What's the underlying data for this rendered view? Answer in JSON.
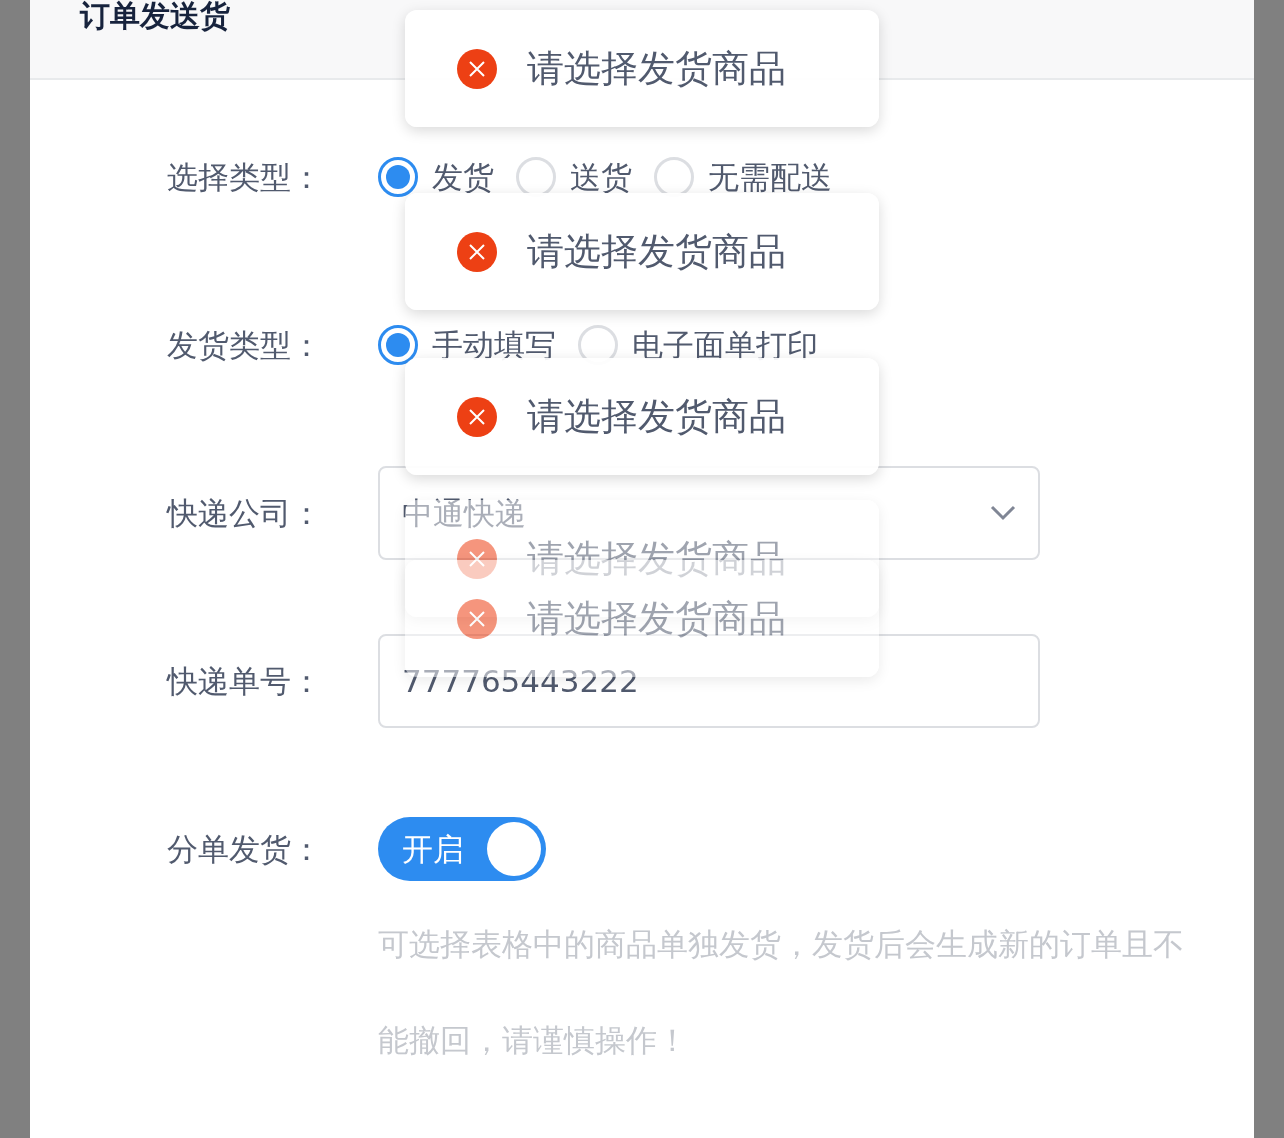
{
  "dialog": {
    "title": "订单发送货"
  },
  "form": [
    {
      "kind": "radio",
      "label": "选择类型：",
      "options": [
        {
          "label": "发货",
          "selected": true
        },
        {
          "label": "送货",
          "selected": false
        },
        {
          "label": "无需配送",
          "selected": false
        }
      ]
    },
    {
      "kind": "radio",
      "label": "发货类型：",
      "options": [
        {
          "label": "手动填写",
          "selected": true
        },
        {
          "label": "电子面单打印",
          "selected": false
        }
      ]
    },
    {
      "kind": "select",
      "label": "快递公司：",
      "value": "中通快递"
    },
    {
      "kind": "input",
      "label": "快递单号：",
      "value": "777765443222"
    },
    {
      "kind": "switch",
      "label": "分单发货：",
      "on": true,
      "state_text": "开启",
      "help": "可选择表格中的商品单独发货，发货后会生成新的订单且不能撤回，请谨慎操作！"
    }
  ],
  "toasts": [
    {
      "kind": "error",
      "message": "请选择发货商品",
      "fading": false
    },
    {
      "kind": "error",
      "message": "请选择发货商品",
      "fading": false
    },
    {
      "kind": "error",
      "message": "请选择发货商品",
      "fading": false
    },
    {
      "kind": "error",
      "message": "请选择发货商品",
      "fading": true
    },
    {
      "kind": "error",
      "message": "请选择发货商品",
      "fading": true
    }
  ]
}
